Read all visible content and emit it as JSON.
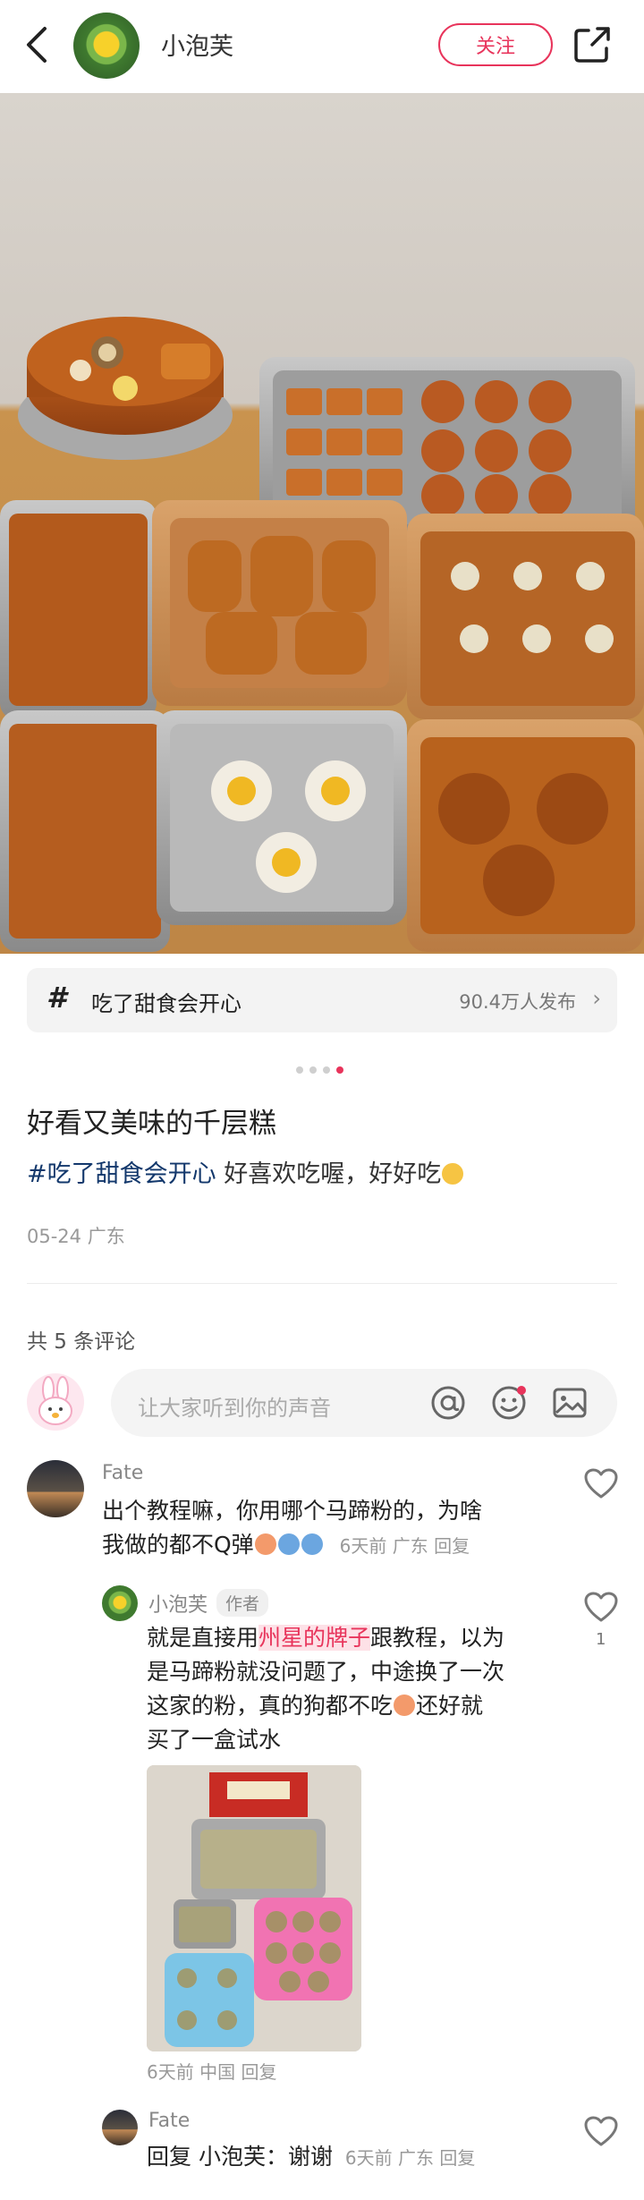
{
  "header": {
    "author_name": "小泡芙",
    "follow_label": "关注",
    "back_icon": "chevron-left-icon",
    "share_icon": "share-out-icon"
  },
  "topic": {
    "label": "吃了甜食会开心",
    "count_text": "90.4万人发布",
    "chevron": "›"
  },
  "carousel": {
    "total": 4,
    "active": 4
  },
  "post": {
    "title": "好看又美味的千层糕",
    "tag_text": "#吃了甜食会开心",
    "body_text": " 好喜欢吃喔，好好吃",
    "meta": "05-24 广东"
  },
  "comments_section": {
    "count_text": "共 5 条评论",
    "input_placeholder": "让大家听到你的声音"
  },
  "comments": [
    {
      "name": "Fate",
      "line1": "出个教程嘛，你用哪个马蹄粉的，为啥",
      "line2_text": "我做的都不Q弹",
      "meta": "6天前  广东  回复"
    }
  ],
  "reply": {
    "name": "小泡芙",
    "badge": "作者",
    "line1_pre": "就是直接用",
    "line1_hl": "州星的牌子",
    "line1_post": "跟教程，以为",
    "line2": "是马蹄粉就没问题了，中途换了一次",
    "line3_pre": "这家的粉，真的狗都不吃",
    "line3_post": "还好就",
    "line4": "买了一盒试水",
    "meta": "6天前  中国  回复",
    "likes": "1"
  },
  "reply2": {
    "name": "Fate",
    "text": "回复 小泡芙：谢谢",
    "meta": "6天前  广东  回复"
  },
  "colors": {
    "accent": "#e8345b",
    "tag_blue": "#13386c",
    "muted": "#999999"
  }
}
